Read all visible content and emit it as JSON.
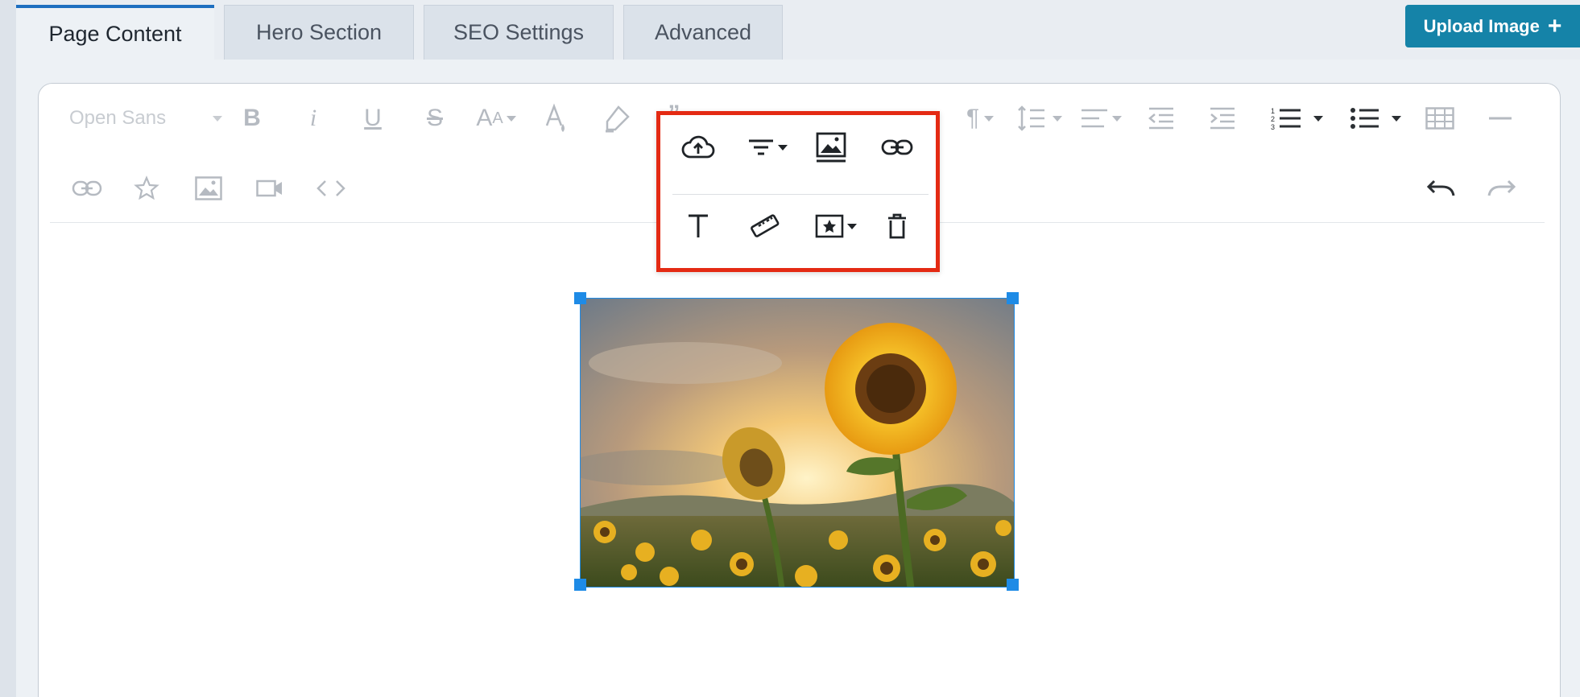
{
  "tabs": [
    {
      "label": "Page Content",
      "active": true
    },
    {
      "label": "Hero Section",
      "active": false
    },
    {
      "label": "SEO Settings",
      "active": false
    },
    {
      "label": "Advanced",
      "active": false
    }
  ],
  "upload_button": {
    "label": "Upload Image",
    "icon": "plus-icon"
  },
  "toolbar": {
    "font_family": "Open Sans",
    "row1_icons": [
      "bold-icon",
      "italic-icon",
      "underline-icon",
      "strikethrough-icon",
      "font-size-icon",
      "text-color-icon",
      "highlight-icon",
      "quote-icon",
      "paragraph-format-icon",
      "line-height-icon",
      "align-icon",
      "outdent-icon",
      "indent-icon",
      "ordered-list-icon",
      "unordered-list-icon",
      "table-icon",
      "horizontal-line-icon"
    ],
    "row2_icons": [
      "insert-link-icon",
      "emoticons-icon",
      "insert-image-icon",
      "insert-video-icon",
      "code-view-icon",
      "undo-icon",
      "redo-icon"
    ]
  },
  "image_popup": {
    "buttons_row1": [
      "replace-image-icon",
      "image-align-icon",
      "image-display-icon",
      "image-link-icon"
    ],
    "buttons_row2": [
      "alt-text-icon",
      "image-size-icon",
      "image-style-icon",
      "remove-image-icon"
    ]
  },
  "selected_image": {
    "subject": "sunflowers-at-sunset",
    "selected": true
  },
  "colors": {
    "accent": "#1583a8",
    "active_tab_border": "#1e6fc0",
    "highlight_box": "#e42a13",
    "selection": "#1e8be6"
  }
}
